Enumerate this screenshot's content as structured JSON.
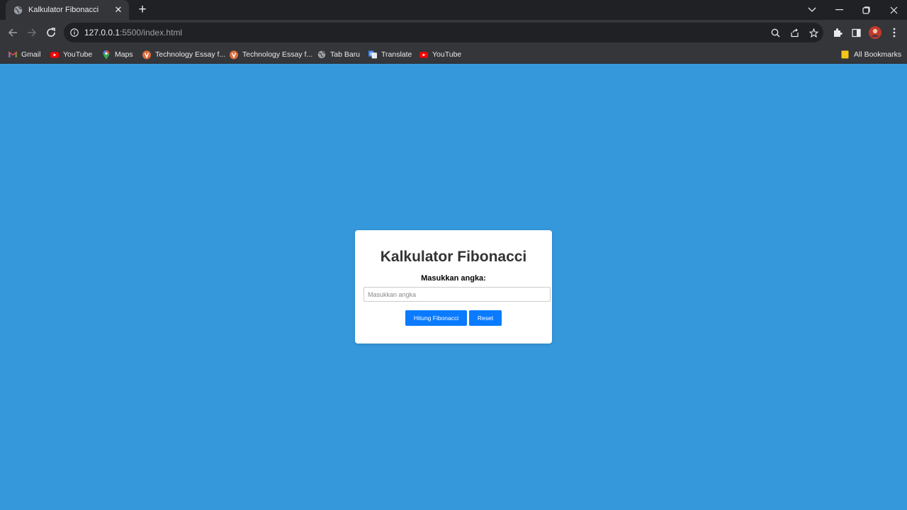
{
  "browser": {
    "tab_title": "Kalkulator Fibonacci",
    "tab_close": "✕",
    "new_tab": "+",
    "url_host": "127.0.0.1",
    "url_rest": ":5500/index.html",
    "bookmarks": [
      {
        "label": "Gmail",
        "icon": "gmail-icon"
      },
      {
        "label": "YouTube",
        "icon": "youtube-icon"
      },
      {
        "label": "Maps",
        "icon": "maps-icon"
      },
      {
        "label": "Technology Essay f...",
        "icon": "v-site-icon"
      },
      {
        "label": "Technology Essay f...",
        "icon": "v-site-icon"
      },
      {
        "label": "Tab Baru",
        "icon": "globe-icon"
      },
      {
        "label": "Translate",
        "icon": "translate-icon"
      },
      {
        "label": "YouTube",
        "icon": "youtube-icon"
      }
    ],
    "all_bookmarks": "All Bookmarks"
  },
  "page": {
    "title": "Kalkulator Fibonacci",
    "input_label": "Masukkan angka:",
    "input_placeholder": "Masukkan angka",
    "input_value": "",
    "calc_button": "Hitung Fibonacci",
    "reset_button": "Reset"
  },
  "colors": {
    "page_background": "#3598db",
    "button": "#0a7bff",
    "card": "#ffffff"
  }
}
